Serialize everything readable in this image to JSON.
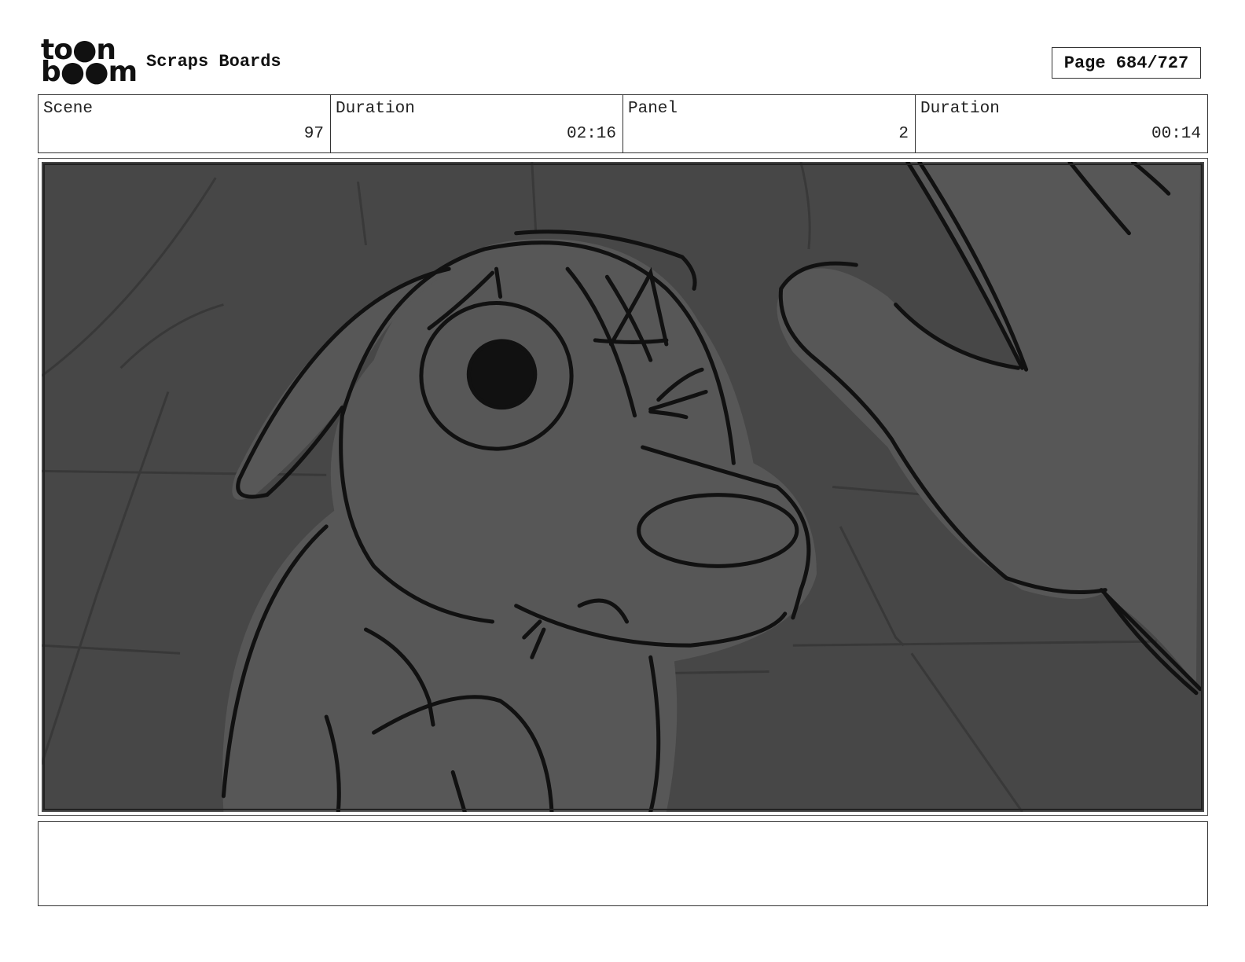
{
  "header": {
    "logo": {
      "alt_text": "toon boom",
      "line1": "to●n",
      "line2": "b●●m"
    },
    "title": "Scraps Boards",
    "page_label": "Page 684/727"
  },
  "info": {
    "scene": {
      "label": "Scene",
      "value": "97"
    },
    "scene_duration": {
      "label": "Duration",
      "value": "02:16"
    },
    "panel": {
      "label": "Panel",
      "value": "2"
    },
    "panel_duration": {
      "label": "Duration",
      "value": "00:14"
    }
  },
  "panel_image": {
    "description_icon": "storyboard-sketch-dog-icon"
  },
  "notes": {
    "text": ""
  },
  "colors": {
    "background": "#474747",
    "figure": "#575757",
    "ink": "#111111"
  }
}
